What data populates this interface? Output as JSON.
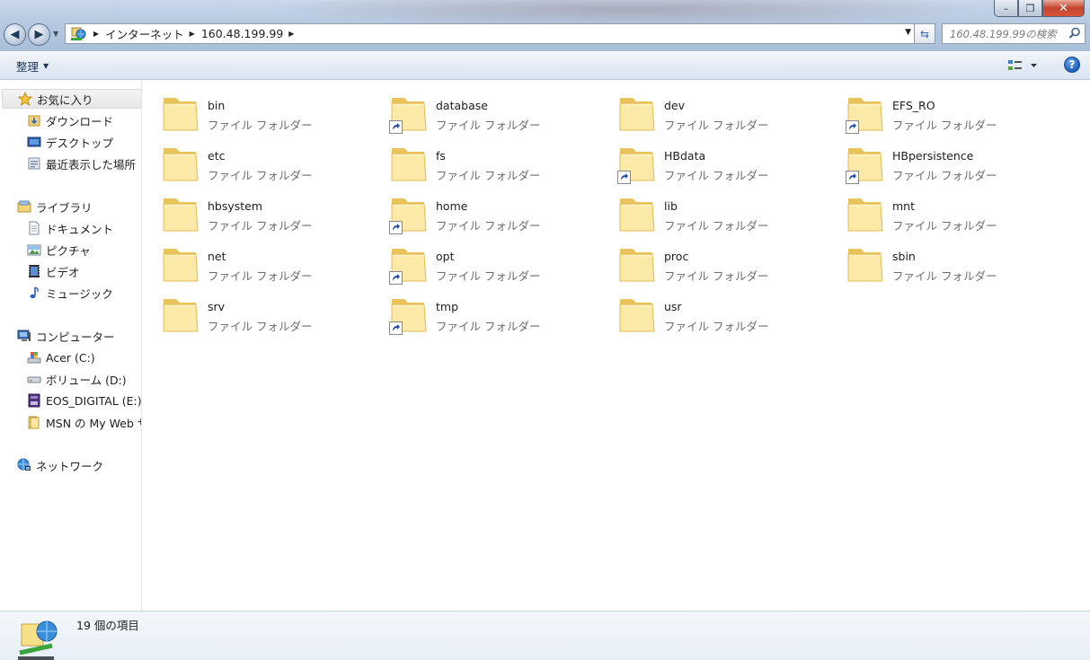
{
  "window": {
    "minimize_label": "–",
    "maximize_label": "❐",
    "close_label": "✕"
  },
  "address": {
    "crumbs": [
      "インターネット",
      "160.48.199.99"
    ]
  },
  "search": {
    "placeholder": "160.48.199.99の検索"
  },
  "toolbar": {
    "organize_label": "整理"
  },
  "sidebar": {
    "favorites": {
      "label": "お気に入り",
      "items": [
        "ダウンロード",
        "デスクトップ",
        "最近表示した場所"
      ]
    },
    "libraries": {
      "label": "ライブラリ",
      "items": [
        "ドキュメント",
        "ピクチャ",
        "ビデオ",
        "ミュージック"
      ]
    },
    "computer": {
      "label": "コンピューター",
      "items": [
        "Acer (C:)",
        "ボリューム (D:)",
        "EOS_DIGITAL (E:)",
        "MSN の My Web サ"
      ]
    },
    "network": {
      "label": "ネットワーク"
    }
  },
  "folder_type": "ファイル フォルダー",
  "folders": [
    {
      "name": "bin",
      "shortcut": false
    },
    {
      "name": "database",
      "shortcut": true
    },
    {
      "name": "dev",
      "shortcut": false
    },
    {
      "name": "EFS_RO",
      "shortcut": true
    },
    {
      "name": "etc",
      "shortcut": false
    },
    {
      "name": "fs",
      "shortcut": false
    },
    {
      "name": "HBdata",
      "shortcut": true
    },
    {
      "name": "HBpersistence",
      "shortcut": true
    },
    {
      "name": "hbsystem",
      "shortcut": false
    },
    {
      "name": "home",
      "shortcut": true
    },
    {
      "name": "lib",
      "shortcut": false
    },
    {
      "name": "mnt",
      "shortcut": false
    },
    {
      "name": "net",
      "shortcut": false
    },
    {
      "name": "opt",
      "shortcut": true
    },
    {
      "name": "proc",
      "shortcut": false
    },
    {
      "name": "sbin",
      "shortcut": false
    },
    {
      "name": "srv",
      "shortcut": false
    },
    {
      "name": "tmp",
      "shortcut": true
    },
    {
      "name": "usr",
      "shortcut": false
    }
  ],
  "status": {
    "item_count": "19 個の項目"
  },
  "colors": {
    "folder_light": "#fbe9a8",
    "folder_dark": "#e9c45c",
    "shortcut_arrow": "#1f4f9b"
  }
}
